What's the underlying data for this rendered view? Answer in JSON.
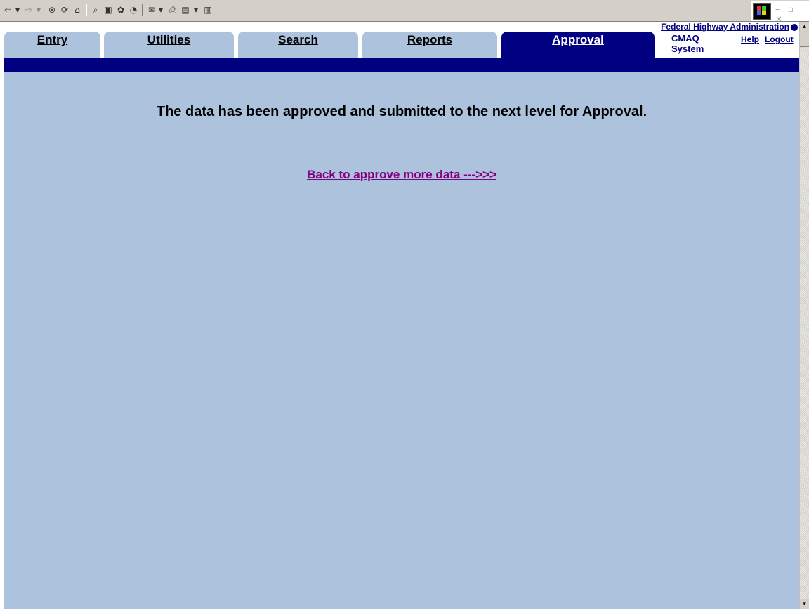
{
  "browser": {
    "toolbar_icons": [
      "back-icon",
      "dropdown-icon",
      "forward-icon",
      "dropdown-icon",
      "stop-icon",
      "refresh-icon",
      "home-icon",
      "search-icon",
      "favorites-icon",
      "history-icon",
      "media-icon",
      "mail-icon",
      "print-icon",
      "edit-icon",
      "dropdown-icon",
      "discuss-icon"
    ]
  },
  "header": {
    "fhwa_link": "Federal Highway Administration",
    "system_label": "CMAQ System",
    "help": "Help",
    "logout": "Logout"
  },
  "tabs": [
    {
      "label": "Entry",
      "active": false
    },
    {
      "label": "Utilities",
      "active": false
    },
    {
      "label": "Search",
      "active": false
    },
    {
      "label": "Reports",
      "active": false
    },
    {
      "label": "Approval",
      "active": true
    }
  ],
  "main": {
    "message": "The data has been approved and submitted to the next level for Approval.",
    "back_link": "Back to approve more data --->>>"
  },
  "colors": {
    "content_bg": "#adc2dd",
    "nav_bar": "#000080",
    "link_visited": "#800080"
  }
}
